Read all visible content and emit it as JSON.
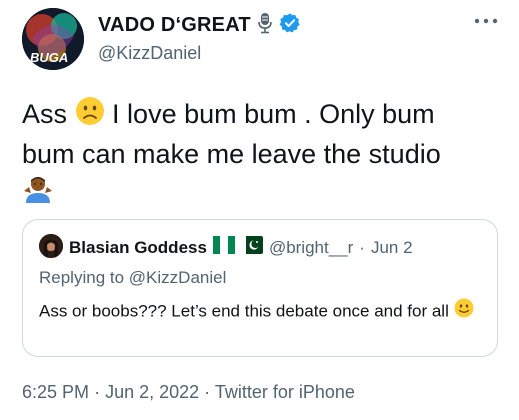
{
  "author": {
    "display_name": "VADO D‘GREAT",
    "handle": "@KizzDaniel",
    "avatar_text": "BUGA"
  },
  "tweet": {
    "text_part1": "Ass",
    "text_part2": "I love bum bum . Only bum bum can make me leave the studio"
  },
  "quote": {
    "display_name": "Blasian Goddess",
    "handle": "@bright__r",
    "separator": "·",
    "date": "Jun 2",
    "replying_to_label": "Replying to",
    "replying_to_handle": "@KizzDaniel",
    "text": "Ass or boobs??? Let’s end this debate once and for all"
  },
  "footer": {
    "time": "6:25 PM",
    "separator": "·",
    "date": "Jun 2, 2022",
    "source": "Twitter for iPhone"
  },
  "colors": {
    "verified_blue": "#1d9bf0",
    "secondary_text": "#536471",
    "border": "#cfd9de"
  }
}
